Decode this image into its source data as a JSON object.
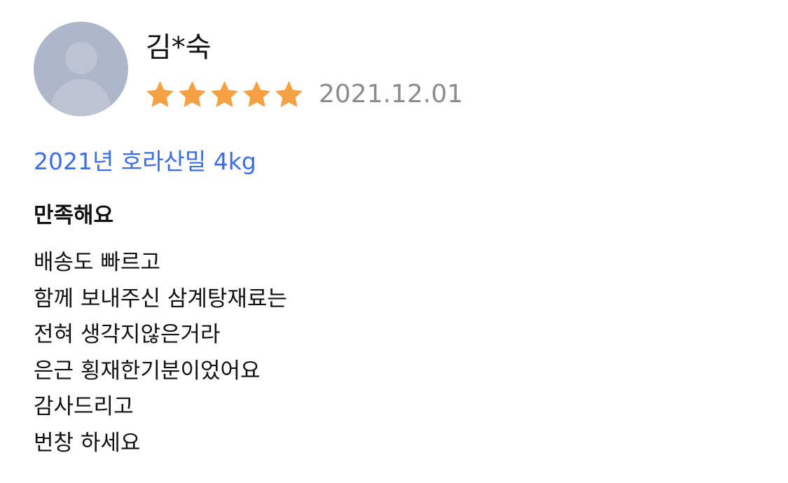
{
  "review": {
    "reviewer_name": "김*숙",
    "rating": 5,
    "rating_max": 5,
    "date": "2021.12.01",
    "product_option": "2021년 호라산밀 4kg",
    "title": "만족해요",
    "body_lines": [
      "배송도 빠르고",
      "함께 보내주신 삼계탕재료는",
      "전혀 생각지않은거라",
      "은근 횡재한기분이었어요",
      "감사드리고",
      "번창 하세요"
    ]
  },
  "colors": {
    "star": "#f5a042",
    "date": "#8c8c8c",
    "option_link": "#3d6ce8",
    "avatar_bg": "#aeb7c9",
    "avatar_figure": "#bcc4d4"
  },
  "icons": {
    "avatar": "avatar-placeholder-icon",
    "star": "star-icon"
  }
}
